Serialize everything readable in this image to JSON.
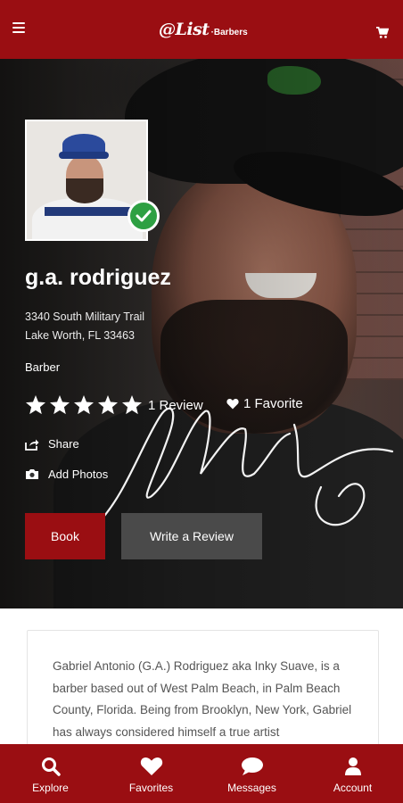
{
  "app": {
    "logo_main": "@List",
    "logo_sub": "·Barbers"
  },
  "icons": {
    "menu": "hamburger-icon",
    "cart": "cart-icon"
  },
  "profile": {
    "name": "g.a. rodriguez",
    "address_line1": "3340 South Military Trail",
    "address_line2": "Lake Worth, FL 33463",
    "role": "Barber",
    "rating_stars": 5,
    "reviews_label": "1 Review",
    "favorites_label": "1 Favorite",
    "verified": true
  },
  "actions": {
    "share": "Share",
    "add_photos": "Add Photos"
  },
  "buttons": {
    "book": "Book",
    "write_review": "Write a Review"
  },
  "bio": {
    "text": "Gabriel Antonio (G.A.) Rodriguez aka Inky Suave, is a barber based out of West Palm Beach, in Palm Beach County, Florida. Being from Brooklyn, New York, Gabriel has always considered himself a true artist"
  },
  "nav": {
    "items": [
      {
        "label": "Explore",
        "icon": "search-icon"
      },
      {
        "label": "Favorites",
        "icon": "heart-icon"
      },
      {
        "label": "Messages",
        "icon": "chat-icon"
      },
      {
        "label": "Account",
        "icon": "user-icon"
      }
    ]
  },
  "colors": {
    "brand": "#9a0e12",
    "secondary_button": "#4a4a4a",
    "verified": "#2ea043"
  }
}
